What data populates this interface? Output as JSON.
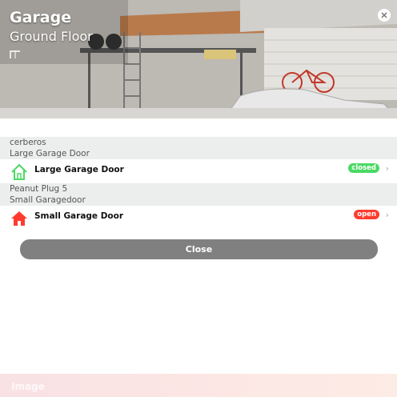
{
  "header": {
    "title": "Garage",
    "subtitle": "Ground Floor"
  },
  "groups": [
    {
      "device": "cerberos",
      "item_group": "Large Garage Door",
      "item": {
        "label": "Large Garage Door",
        "status": "closed",
        "status_color": "#4cd964",
        "icon_color": "#4cd964"
      }
    },
    {
      "device": "Peanut Plug 5",
      "item_group": "Small Garagedoor",
      "item": {
        "label": "Small Garage Door",
        "status": "open",
        "status_color": "#ff3b30",
        "icon_color": "#ff3b30"
      }
    }
  ],
  "dialog": {
    "close_label": "Close"
  },
  "footer": {
    "label": "Image"
  }
}
